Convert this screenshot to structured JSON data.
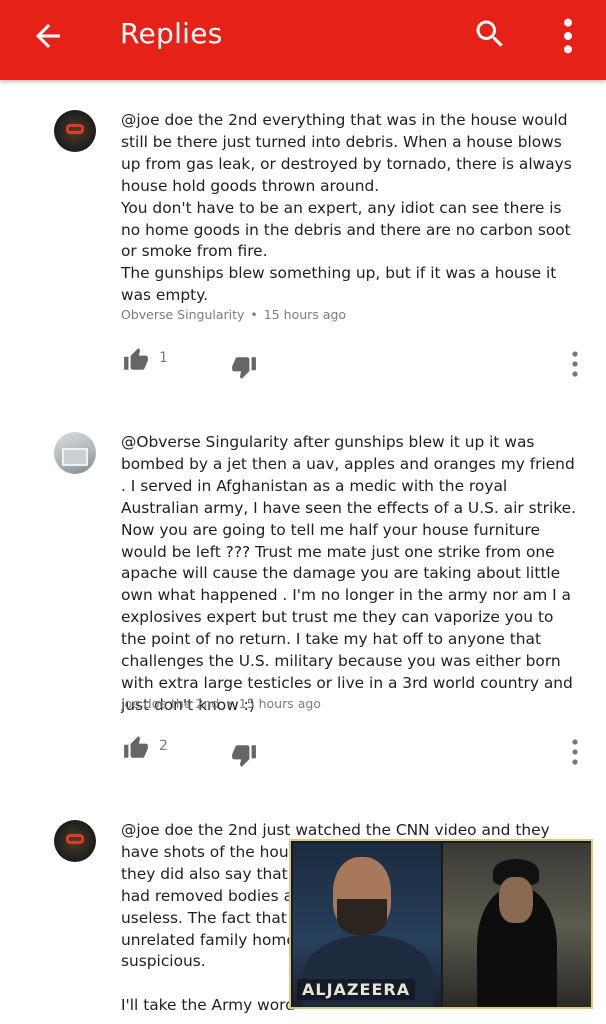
{
  "appbar": {
    "title": "Replies",
    "back_icon": "arrow-back-icon",
    "search_icon": "search-icon",
    "more_icon": "more-vert-icon",
    "color": "#e62117"
  },
  "comments": [
    {
      "paragraphs": [
        "@joe doe the 2nd everything that was in the house would still be there just turned into debris. When a house blows up from gas leak, or destroyed by tornado, there is always house hold goods thrown around.",
        "You don't have to be an expert, any idiot can see there is no home goods in the debris and there are no carbon soot or smoke from fire.",
        "The gunships blew something up, but if it was a house it was empty."
      ],
      "author": "Obverse Singularity",
      "time": "15 hours ago",
      "likes": "1"
    },
    {
      "paragraphs": [
        "@Obverse Singularity after gunships blew it up it was bombed by a jet then a uav,  apples and oranges my friend . I served in Afghanistan as a medic with the royal Australian army,  I have seen the effects of a U.S. air strike.  Now you are going to tell me half your house furniture would be left ??? Trust me mate just one strike from one apache will cause the damage you are taking about little own what happened . I'm no longer in the army nor am I a explosives expert but trust me they can vaporize you to the point of no return.  I take my hat off to anyone that challenges the U.S. military because you was either born with extra large testicles or live in a 3rd world country and just don't know :)"
      ],
      "author": "joe doe the 2nd",
      "time": "15 hours ago",
      "likes": "2"
    },
    {
      "paragraphs": [
        "@joe doe the 2nd just watched the CNN video and they have shots of the household i",
        "they did also say that I",
        "had removed bodies and",
        "useless. The fact that t",
        "unrelated family home a",
        "suspicious.",
        "",
        "I'll take the Army word"
      ]
    }
  ],
  "video_overlay": {
    "brand": "ALJAZEERA"
  }
}
